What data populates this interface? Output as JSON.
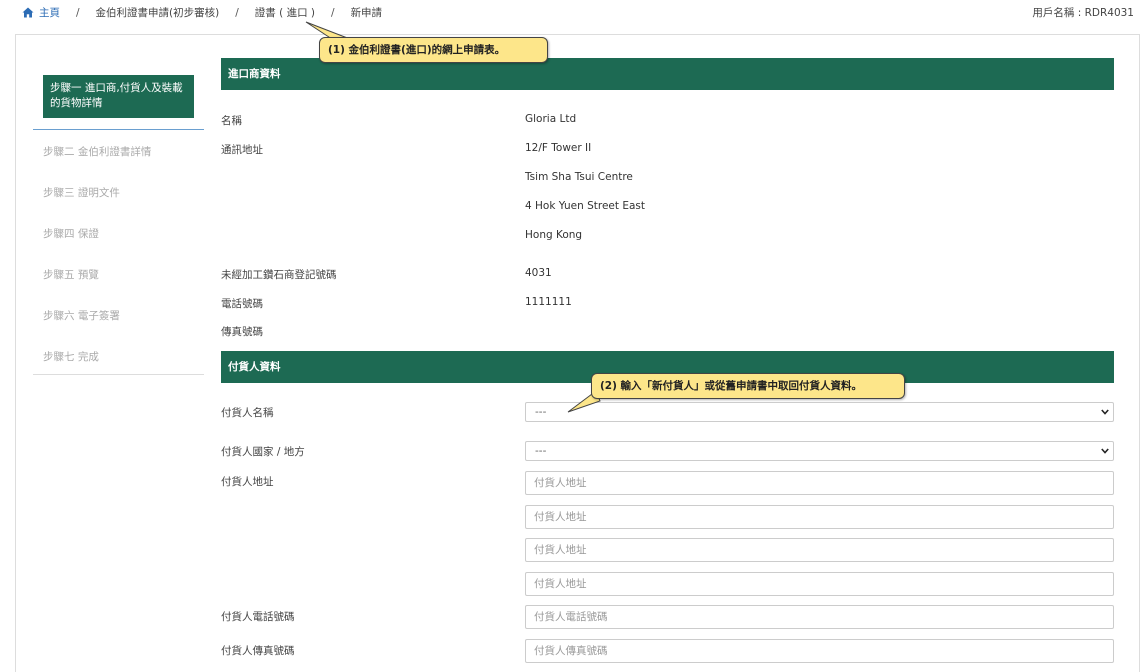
{
  "breadcrumb": {
    "home": "主頁",
    "separator": "/",
    "items": [
      "金伯利證書申請(初步審核)",
      "證書 ( 進口 )",
      "新申請"
    ]
  },
  "user": {
    "label": "用戶名稱 : RDR4031"
  },
  "steps": {
    "active": "步驟一 進口商,付貨人及裝載的貨物詳情",
    "others": [
      "步驟二 金伯利證書詳情",
      "步驟三 證明文件",
      "步驟四 保證",
      "步驟五 預覽",
      "步驟六 電子簽署",
      "步驟七 完成"
    ]
  },
  "importer": {
    "header": "進口商資料",
    "name_label": "名稱",
    "name_value": "Gloria Ltd",
    "address_label": "通訊地址",
    "address_lines": [
      "12/F Tower II",
      "Tsim Sha Tsui Centre",
      "4 Hok Yuen Street East",
      "Hong Kong"
    ],
    "reg_label": "未經加工鑽石商登記號碼",
    "reg_value": "4031",
    "phone_label": "電話號碼",
    "phone_value": "1111111",
    "fax_label": "傳真號碼"
  },
  "consignor": {
    "header": "付貨人資料",
    "name_label": "付貨人名稱",
    "name_select": "---",
    "country_label": "付貨人國家 / 地方",
    "country_select": "---",
    "address_label": "付貨人地址",
    "address_placeholder": "付貨人地址",
    "phone_label": "付貨人電話號碼",
    "phone_placeholder": "付貨人電話號碼",
    "fax_label": "付貨人傳真號碼",
    "fax_placeholder": "付貨人傳真號碼"
  },
  "callouts": {
    "one": "(1) 金伯利證書(進口)的網上申請表。",
    "two": "(2) 輸入「新付貨人」或從舊申請書中取回付貨人資料。"
  },
  "colors": {
    "accent": "#1d6a53",
    "link": "#2c6cb5",
    "callout": "#fde68a"
  }
}
